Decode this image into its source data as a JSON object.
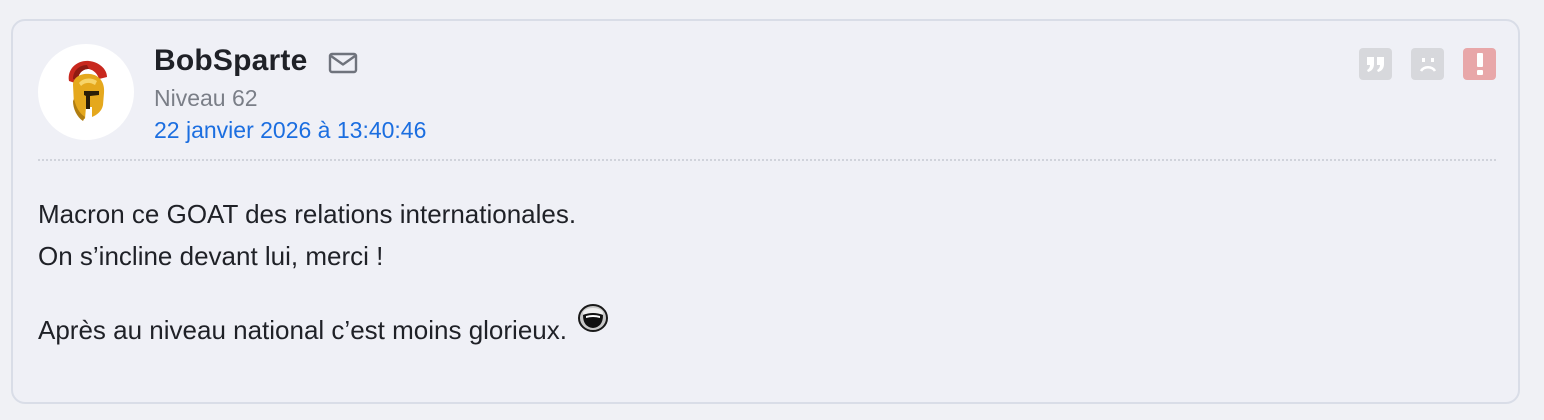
{
  "post": {
    "author": {
      "username": "BobSparte",
      "level": "Niveau 62",
      "avatar_icon": "spartan-helmet-icon"
    },
    "date": "22 janvier 2026 à 13:40:46",
    "actions": [
      {
        "name": "quote",
        "icon": "quote-icon",
        "color": "#d7d8dc"
      },
      {
        "name": "sad",
        "icon": "sad-face-icon",
        "color": "#d7d8dc"
      },
      {
        "name": "report",
        "icon": "exclamation-icon",
        "color": "#e8a7a9"
      }
    ],
    "body": {
      "line1": "Macron ce GOAT des relations internationales.",
      "line2": "On s’incline devant lui, merci !",
      "line3": "Après au niveau national c’est moins glorieux.",
      "emoji": "laughing-smiley-icon"
    }
  },
  "colors": {
    "background": "#f0f1f5",
    "link": "#1b6ee0",
    "report": "#e8a7a9"
  }
}
